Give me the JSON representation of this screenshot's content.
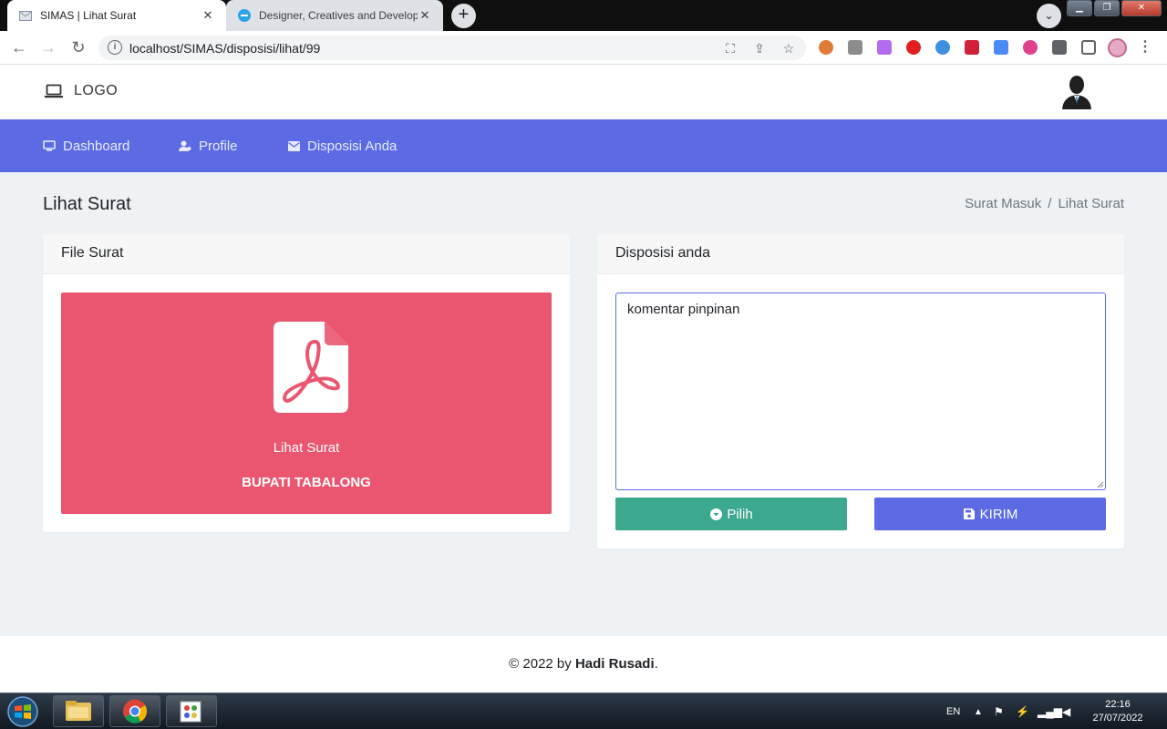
{
  "browser": {
    "tabs": [
      {
        "title": "SIMAS | Lihat Surat",
        "active": true
      },
      {
        "title": "Designer, Creatives and Developers",
        "active": false
      }
    ],
    "new_tab_label": "+",
    "url": "localhost/SIMAS/disposisi/lihat/99"
  },
  "header": {
    "logo_text": "LOGO"
  },
  "nav": {
    "items": [
      {
        "label": "Dashboard",
        "icon": "monitor-icon"
      },
      {
        "label": "Profile",
        "icon": "user-icon"
      },
      {
        "label": "Disposisi Anda",
        "icon": "envelope-icon"
      }
    ]
  },
  "page": {
    "title": "Lihat Surat",
    "breadcrumb": [
      "Surat Masuk",
      "/",
      "Lihat Surat"
    ]
  },
  "file_card": {
    "header": "File Surat",
    "link_label": "Lihat Surat",
    "sender": "BUPATI TABALONG",
    "accent_color": "#ea556f"
  },
  "disposisi_card": {
    "header": "Disposisi anda",
    "comment_value": "komentar pinpinan",
    "pilih_label": "Pilih",
    "kirim_label": "KIRIM"
  },
  "footer": {
    "prefix": "© 2022 by ",
    "author": "Hadi Rusadi",
    "suffix": "."
  },
  "taskbar": {
    "language": "EN",
    "time": "22:16",
    "date": "27/07/2022"
  },
  "colors": {
    "primary": "#5c6be3",
    "success": "#3ca88e",
    "danger": "#ea556f",
    "background": "#eff2f5"
  }
}
